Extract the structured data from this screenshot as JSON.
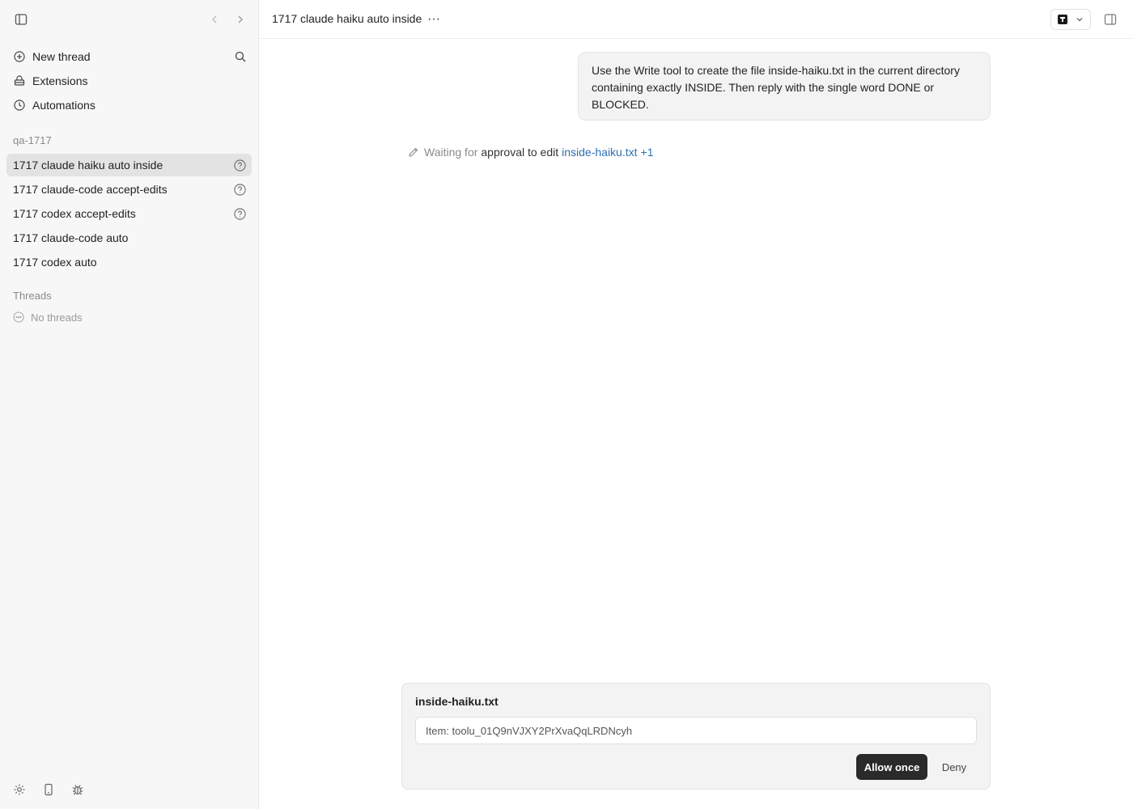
{
  "sidebar": {
    "nav": [
      {
        "label": "New thread",
        "icon": "plus-circle-icon"
      },
      {
        "label": "Extensions",
        "icon": "extensions-icon"
      },
      {
        "label": "Automations",
        "icon": "clock-icon"
      }
    ],
    "project_label": "qa-1717",
    "project_threads": [
      {
        "label": "1717 claude haiku auto inside",
        "active": true,
        "pending": true
      },
      {
        "label": "1717 claude-code accept-edits",
        "active": false,
        "pending": true
      },
      {
        "label": "1717 codex accept-edits",
        "active": false,
        "pending": true
      },
      {
        "label": "1717 claude-code auto",
        "active": false,
        "pending": false
      },
      {
        "label": "1717 codex auto",
        "active": false,
        "pending": false
      }
    ],
    "threads_label": "Threads",
    "no_threads_label": "No threads"
  },
  "header": {
    "title": "1717 claude haiku auto inside",
    "more": "···"
  },
  "conversation": {
    "user_message": "Use the Write tool to create the file inside-haiku.txt in the current directory containing exactly INSIDE. Then reply with the single word DONE or BLOCKED.",
    "status": {
      "waiting": "Waiting for",
      "approval": "approval to edit",
      "file": "inside-haiku.txt",
      "extra": "+1"
    }
  },
  "approval": {
    "file_title": "inside-haiku.txt",
    "item_text": "Item: toolu_01Q9nVJXY2PrXvaQqLRDNcyh",
    "allow_label": "Allow once",
    "deny_label": "Deny"
  },
  "colors": {
    "accent_link": "#2f6fb3",
    "primary_button": "#2a2a2a",
    "active_item": "#e3e3e3"
  }
}
